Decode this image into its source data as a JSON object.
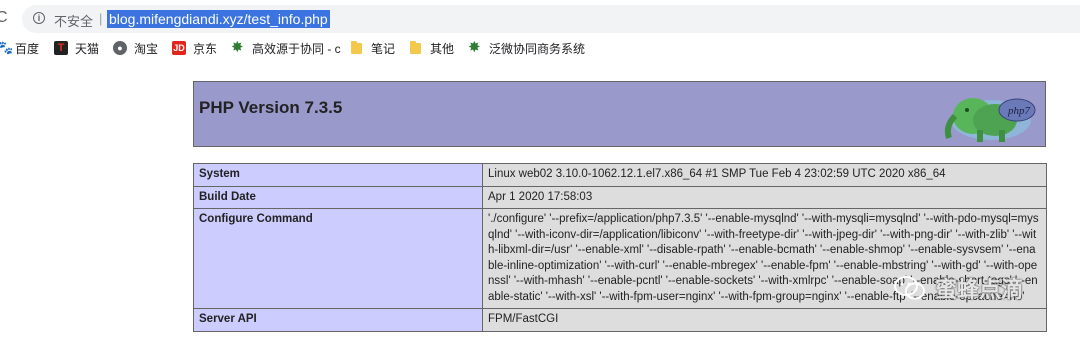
{
  "browser": {
    "security_label": "不安全",
    "separator": "|",
    "url": "blog.mifengdiandi.xyz/test_info.php",
    "info_icon": "info-icon",
    "reload_icon": "reload-icon"
  },
  "bookmarks": [
    {
      "label": "百度",
      "icon": "baidu-paw-icon"
    },
    {
      "label": "天猫",
      "icon": "tmall-icon"
    },
    {
      "label": "淘宝",
      "icon": "globe-icon"
    },
    {
      "label": "京东",
      "icon": "jd-icon"
    },
    {
      "label": "高效源于协同 - c",
      "icon": "gear-icon"
    },
    {
      "label": "笔记",
      "icon": "folder-icon"
    },
    {
      "label": "其他",
      "icon": "folder-icon"
    },
    {
      "label": "泛微协同商务系统",
      "icon": "gear-icon"
    }
  ],
  "php": {
    "title": "PHP Version 7.3.5",
    "logo_text": "php7",
    "rows": [
      {
        "label": "System",
        "value": "Linux web02 3.10.0-1062.12.1.el7.x86_64 #1 SMP Tue Feb 4 23:02:59 UTC 2020 x86_64"
      },
      {
        "label": "Build Date",
        "value": "Apr 1 2020 17:58:03"
      },
      {
        "label": "Configure Command",
        "value": "'./configure' '--prefix=/application/php7.3.5' '--enable-mysqlnd' '--with-mysqli=mysqlnd' '--with-pdo-mysql=mysqlnd' '--with-iconv-dir=/application/libiconv' '--with-freetype-dir' '--with-jpeg-dir' '--with-png-dir' '--with-zlib' '--with-libxml-dir=/usr' '--enable-xml' '--disable-rpath' '--enable-bcmath' '--enable-shmop' '--enable-sysvsem' '--enable-inline-optimization' '--with-curl' '--enable-mbregex' '--enable-fpm' '--enable-mbstring' '--with-gd' '--with-openssl' '--with-mhash' '--enable-pcntl' '--enable-sockets' '--with-xmlrpc' '--enable-soap' '--enable-short-tags' '--enable-static' '--with-xsl' '--with-fpm-user=nginx' '--with-fpm-group=nginx' '--enable-ftp' '--enable-opcache=no'"
      },
      {
        "label": "Server API",
        "value": "FPM/FastCGI"
      }
    ]
  },
  "watermark": {
    "text": "蜜蜂点滴",
    "icon": "wechat-icon"
  }
}
